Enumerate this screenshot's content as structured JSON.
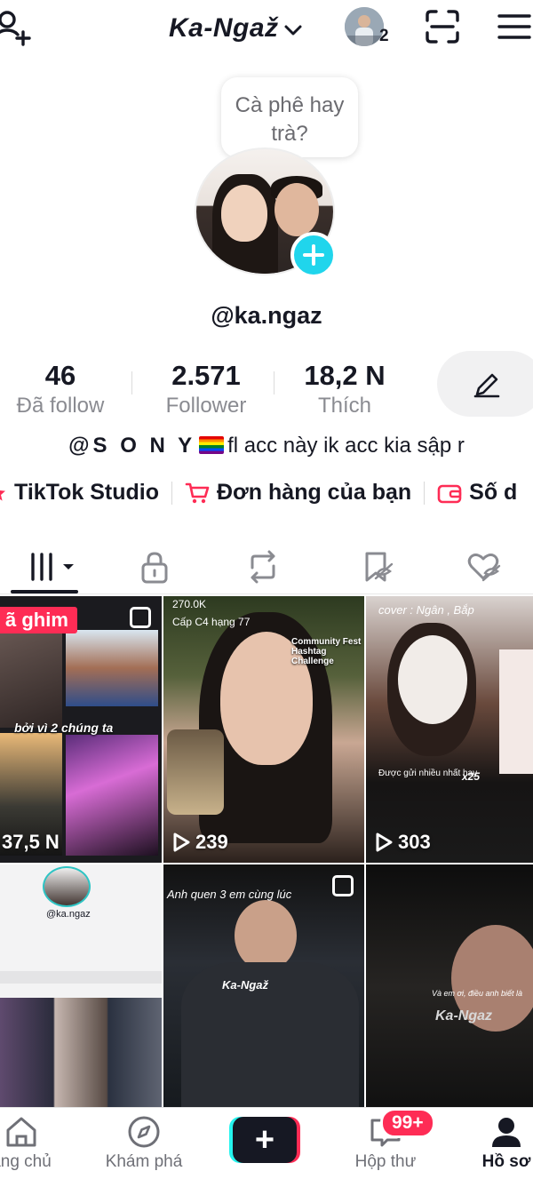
{
  "header": {
    "account_name": "Ka-Ngaž",
    "friends_count": "2"
  },
  "profile": {
    "note": "Cà phê hay trà?",
    "username": "@ka.ngaz",
    "stats": [
      {
        "value": "46",
        "label": "Đã follow"
      },
      {
        "value": "2.571",
        "label": "Follower"
      },
      {
        "value": "18,2 N",
        "label": "Thích"
      }
    ],
    "bio_prefix": "@S O N Y",
    "bio_suffix": "fl acc này ik acc kia sập r"
  },
  "links": [
    {
      "label": "TikTok Studio",
      "icon": "star-icon"
    },
    {
      "label": "Đơn hàng của bạn",
      "icon": "cart-icon"
    },
    {
      "label": "Số d",
      "icon": "wallet-icon"
    }
  ],
  "tabs": [
    {
      "name": "videos-grid",
      "icon": "grid-icon",
      "active": true
    },
    {
      "name": "private",
      "icon": "lock-icon"
    },
    {
      "name": "reposts",
      "icon": "repost-icon"
    },
    {
      "name": "favorites",
      "icon": "bookmark-icon"
    },
    {
      "name": "liked",
      "icon": "heart-icon"
    }
  ],
  "videos": [
    {
      "views": "37,5 N",
      "pinned_label": "ã ghim",
      "caption": "bởi vì 2 chúng ta"
    },
    {
      "views": "239",
      "live_views": "270.0K",
      "caption": "Cấp C4 hạng 77",
      "overlay": "Community Fest Hashtag Challenge"
    },
    {
      "views": "303",
      "caption": "cover : Ngân , Bắp",
      "overlay": "Được gửi nhiều nhất hay",
      "multiplier": "x25"
    },
    {
      "views": "",
      "caption": "@ka.ngaz"
    },
    {
      "views": "",
      "caption": "Anh quen 3 em cùng lúc",
      "watermark": "Ka-Ngaž"
    },
    {
      "views": "",
      "caption": "Và em ơi, điều anh biết là",
      "watermark": "Ka-Ngaz"
    }
  ],
  "bottom_nav": [
    {
      "label": "ang chủ",
      "icon": "home-icon"
    },
    {
      "label": "Khám phá",
      "icon": "compass-icon"
    },
    {
      "label": "",
      "icon": "create-icon"
    },
    {
      "label": "Hộp thư",
      "icon": "inbox-icon",
      "badge": "99+"
    },
    {
      "label": "Hồ sơ",
      "icon": "profile-icon",
      "active": true
    }
  ],
  "colors": {
    "accent": "#fe2c55",
    "cyan": "#20d5ec",
    "text": "#161823",
    "muted": "#8a8b91"
  }
}
